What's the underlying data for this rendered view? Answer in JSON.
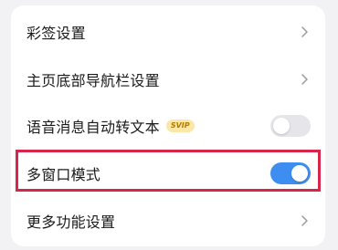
{
  "settings": {
    "items": [
      {
        "label": "彩签设置",
        "control": "chevron"
      },
      {
        "label": "主页底部导航栏设置",
        "control": "chevron"
      },
      {
        "label": "语音消息自动转文本",
        "badge": "SVIP",
        "control": "toggle",
        "toggle_state": "off"
      },
      {
        "label": "多窗口模式",
        "control": "toggle",
        "toggle_state": "on",
        "highlighted": true
      },
      {
        "label": "更多功能设置",
        "control": "chevron"
      }
    ]
  },
  "colors": {
    "toggle_on": "#3d8ef0",
    "toggle_off": "#e6e6ea",
    "highlight_border": "#d8264a",
    "badge_bg": "#fde7a6",
    "badge_text": "#b07a00"
  },
  "icons": {
    "chevron": "chevron-right-icon"
  }
}
